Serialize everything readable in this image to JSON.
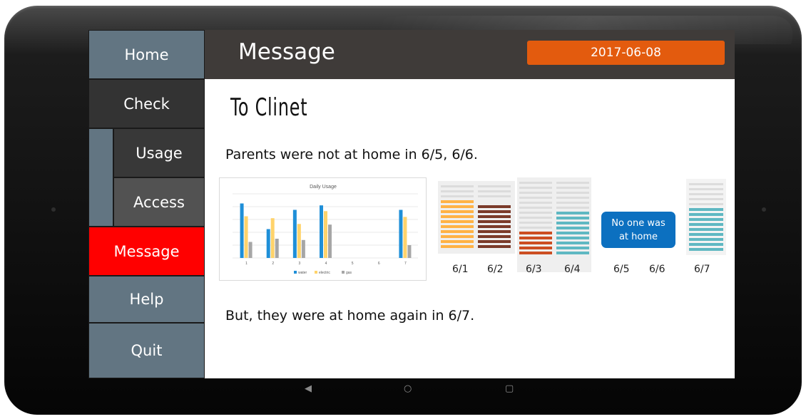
{
  "sidebar": {
    "home": "Home",
    "check": "Check",
    "usage": "Usage",
    "access": "Access",
    "message": "Message",
    "help": "Help",
    "quit": "Quit"
  },
  "header": {
    "title": "Message",
    "date": "2017-06-08"
  },
  "content": {
    "heading": "To Clinet",
    "line1": "Parents were not at home in 6/5, 6/6.",
    "line2": "But, they were at home again in 6/7.",
    "bubble_line1": "No one was",
    "bubble_line2": "at home"
  },
  "day_labels": [
    "6/1",
    "6/2",
    "6/3",
    "6/4",
    "6/5",
    "6/6",
    "6/7"
  ],
  "colors": {
    "water": "#1f8fd8",
    "electric": "#ffd36b",
    "gas": "#a6a6a6",
    "orange_bar": "#ffb245",
    "brown_bar": "#7b3b2a",
    "rust_bar": "#cc4e22",
    "teal_bar": "#5fb8c2",
    "accent": "#e35b0e",
    "active": "#ff0000"
  },
  "chart_data": {
    "type": "bar",
    "title": "Daily Usage",
    "categories": [
      "1",
      "2",
      "3",
      "4",
      "5",
      "6",
      "7"
    ],
    "series": [
      {
        "name": "water",
        "values": [
          85,
          45,
          75,
          82,
          0,
          0,
          75
        ]
      },
      {
        "name": "electric",
        "values": [
          65,
          62,
          53,
          73,
          0,
          0,
          64
        ]
      },
      {
        "name": "gas",
        "values": [
          25,
          30,
          28,
          52,
          0,
          0,
          20
        ]
      }
    ],
    "ylim": [
      0,
      100
    ],
    "grid": true,
    "legend": "bottom"
  },
  "system_bar": {
    "back": "◀",
    "home": "○",
    "recent": "▢"
  }
}
